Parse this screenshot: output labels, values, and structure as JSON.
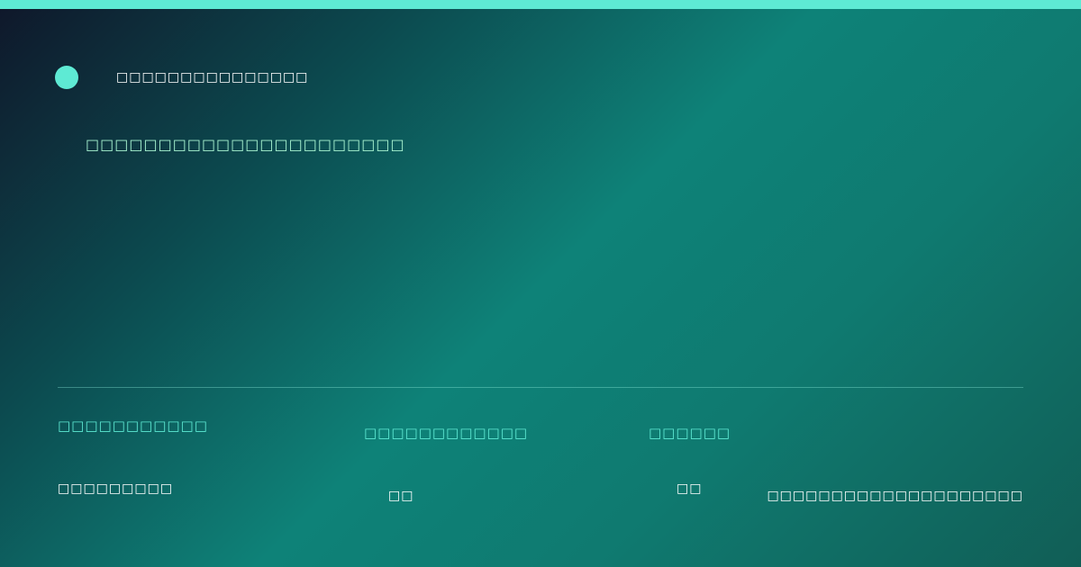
{
  "colors": {
    "accent": "#5eead4",
    "headline_text": "#a7f3d0",
    "background_start": "#0f172a",
    "background_mid": "#0e8278",
    "background_end": "#115e56"
  },
  "header": {
    "brand_icon": "circle-dot-icon",
    "brand_label": "□□□□□□□□□□□□□□□"
  },
  "main": {
    "headline": "□□□□□□□□□□□□□□□□□□□□□□"
  },
  "stats": [
    {
      "label": "□□□□□□□□□□□",
      "value": "□□□□□□□□□"
    },
    {
      "label": "□□□□□□□□□□□□",
      "value": "□□"
    },
    {
      "label": "□□□□□□",
      "value": "□□"
    }
  ],
  "footer": {
    "text": "□□□□□□□□□□□□□□□□□□□□"
  }
}
